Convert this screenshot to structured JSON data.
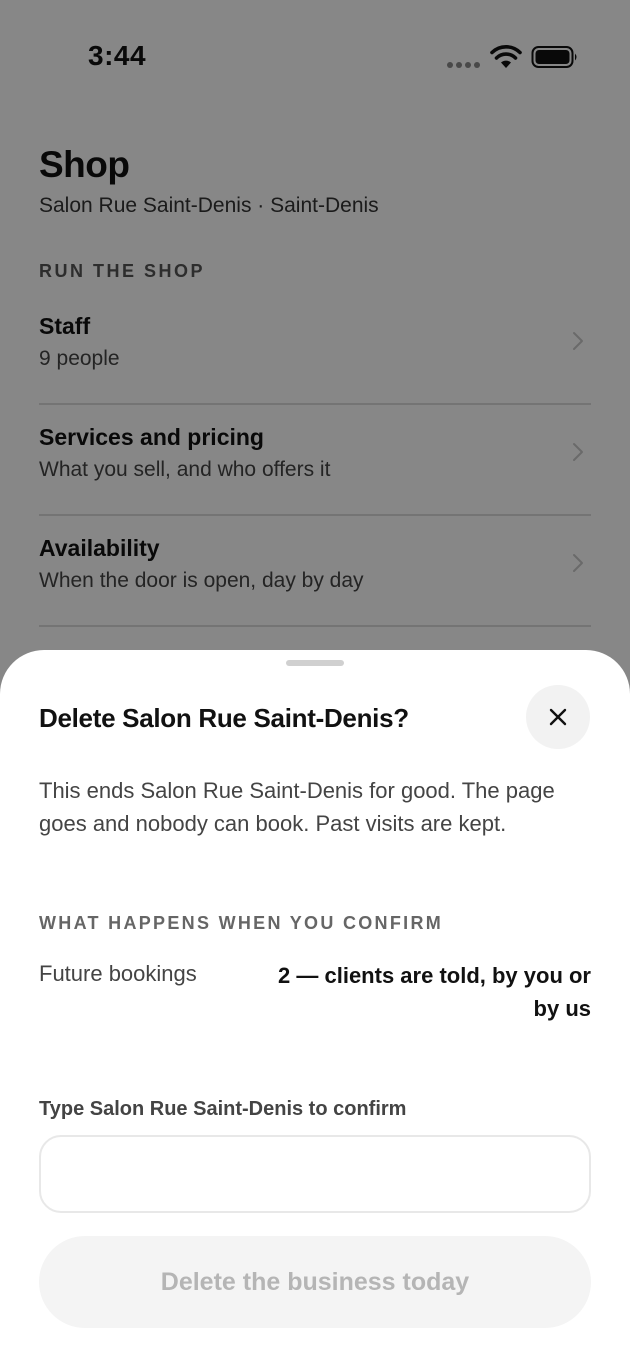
{
  "status_bar": {
    "time": "3:44"
  },
  "page": {
    "title": "Shop",
    "subtitle": "Salon Rue Saint-Denis · Saint-Denis",
    "section_label": "RUN THE SHOP",
    "rows": [
      {
        "title": "Staff",
        "subtitle": "9 people"
      },
      {
        "title": "Services and pricing",
        "subtitle": "What you sell, and who offers it"
      },
      {
        "title": "Availability",
        "subtitle": "When the door is open, day by day"
      }
    ]
  },
  "sheet": {
    "title": "Delete Salon Rue Saint-Denis?",
    "body": "This ends Salon Rue Saint-Denis for good. The page goes and nobody can book. Past visits are kept.",
    "consequence_label": "WHAT HAPPENS WHEN YOU CONFIRM",
    "consequence_key": "Future bookings",
    "consequence_value": "2 — clients are told, by you or by us",
    "confirm_label": "Type Salon Rue Saint-Denis to confirm",
    "confirm_input_value": "",
    "confirm_input_placeholder": "",
    "delete_button_label": "Delete the business today",
    "delete_button_state": "disabled"
  },
  "icons": {
    "close": "close-icon",
    "chevron": "chevron-right-icon",
    "wifi": "wifi-icon",
    "battery": "battery-icon",
    "signal": "cellular-signal-icon"
  }
}
